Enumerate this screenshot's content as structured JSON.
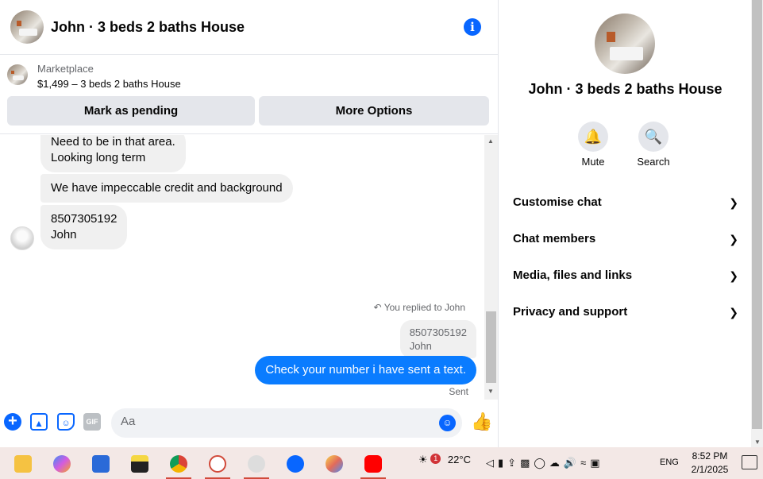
{
  "header": {
    "title": "John · 3 beds 2 baths House",
    "info_icon": "info-icon"
  },
  "marketplace": {
    "label": "Marketplace",
    "listing": "$1,499 – 3 beds 2 baths House",
    "mark_pending": "Mark as pending",
    "more_options": "More Options"
  },
  "messages": {
    "incoming": [
      {
        "line1": "Need to be in that area.",
        "line2": "Looking long term"
      },
      {
        "line1": "We have impeccable credit and background"
      },
      {
        "line1": "8507305192",
        "line2": "John"
      }
    ],
    "replied_label": "You replied to John",
    "quoted": {
      "line1": "8507305192",
      "line2": "John"
    },
    "outgoing": "Check your number i have sent a text.",
    "status": "Sent"
  },
  "composer": {
    "placeholder": "Aa",
    "gif_label": "GIF"
  },
  "sidebar": {
    "name": "John · 3 beds 2 baths House",
    "actions": [
      {
        "label": "Mute",
        "icon": "bell-icon"
      },
      {
        "label": "Search",
        "icon": "search-icon"
      }
    ],
    "sections": [
      {
        "label": "Customise chat"
      },
      {
        "label": "Chat members"
      },
      {
        "label": "Media, files and links"
      },
      {
        "label": "Privacy and support"
      }
    ]
  },
  "taskbar": {
    "weather": "22°C",
    "weather_badge": "1",
    "language": "ENG",
    "time": "8:52 PM",
    "date": "2/1/2025"
  },
  "colors": {
    "accent": "#0866ff",
    "outgoing_bubble": "#0a7cff",
    "incoming_bubble": "#f0f0f0",
    "button_bg": "#e4e6eb"
  }
}
